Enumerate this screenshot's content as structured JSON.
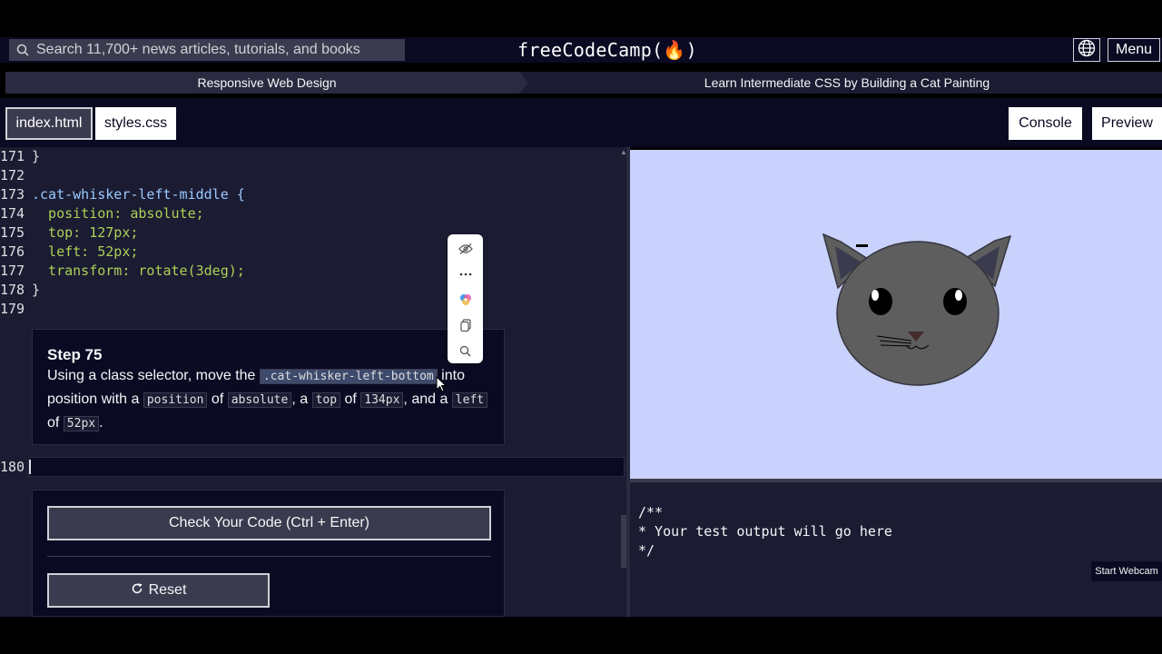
{
  "header": {
    "search_placeholder": "Search 11,700+ news articles, tutorials, and books",
    "brand": "freeCodeCamp(🔥)",
    "menu_label": "Menu"
  },
  "breadcrumb": {
    "course": "Responsive Web Design",
    "project": "Learn Intermediate CSS by Building a Cat Painting"
  },
  "tabs": {
    "file1": "index.html",
    "file2": "styles.css",
    "console": "Console",
    "preview": "Preview"
  },
  "editor": {
    "lines": [
      {
        "n": "171",
        "code": "}"
      },
      {
        "n": "172",
        "code": ""
      },
      {
        "n": "173",
        "code": ".cat-whisker-left-middle {"
      },
      {
        "n": "174",
        "code": "  position: absolute;"
      },
      {
        "n": "175",
        "code": "  top: 127px;"
      },
      {
        "n": "176",
        "code": "  left: 52px;"
      },
      {
        "n": "177",
        "code": "  transform: rotate(3deg);"
      },
      {
        "n": "178",
        "code": "}"
      },
      {
        "n": "179",
        "code": ""
      }
    ],
    "active_line_number": "180"
  },
  "instructions": {
    "title": "Step 75",
    "text_1": "Using a class selector, move the ",
    "code_1": ".cat-whisker-left-bottom",
    "text_2": " into position with a ",
    "code_2": "position",
    "text_3": " of ",
    "code_3": "absolute",
    "text_4": ", a ",
    "code_4": "top",
    "text_5": " of ",
    "code_5": "134px",
    "text_6": ", and a ",
    "code_6": "left",
    "text_7": " of ",
    "code_7": "52px",
    "text_8": "."
  },
  "actions": {
    "check_label": "Check Your Code (Ctrl + Enter)",
    "reset_label": "Reset"
  },
  "console": {
    "output": "/**\n* Your test output will go here\n*/"
  },
  "webcam_label": "Start Webcam",
  "colors": {
    "bg_dark": "#0a0a23",
    "editor_bg": "#1b1b32",
    "preview_bg": "#c9d2fc",
    "cat_gray": "#5e5e5e"
  }
}
